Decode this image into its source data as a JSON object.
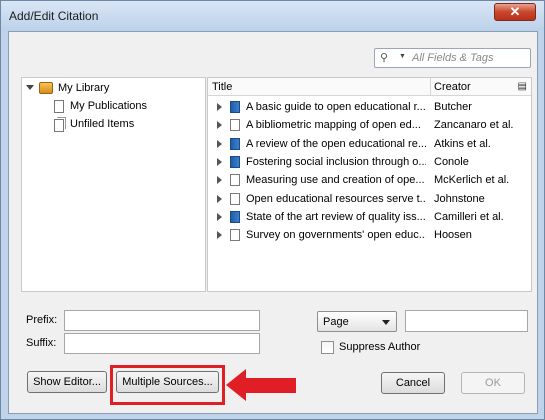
{
  "window": {
    "title": "Add/Edit Citation",
    "close_label": "✕"
  },
  "search": {
    "placeholder": "All Fields & Tags"
  },
  "tree": {
    "items": [
      {
        "label": "My Library"
      },
      {
        "label": "My Publications"
      },
      {
        "label": "Unfiled Items"
      }
    ]
  },
  "table": {
    "headers": {
      "title": "Title",
      "creator": "Creator"
    },
    "rows": [
      {
        "title": "A basic guide to open educational r...",
        "creator": "Butcher",
        "icon": "book"
      },
      {
        "title": "A bibliometric mapping of open ed...",
        "creator": "Zancanaro et al.",
        "icon": "page"
      },
      {
        "title": "A review of the open educational re...",
        "creator": "Atkins et al.",
        "icon": "book"
      },
      {
        "title": "Fostering social inclusion through o...",
        "creator": "Conole",
        "icon": "book"
      },
      {
        "title": "Measuring use and creation of ope...",
        "creator": "McKerlich et al.",
        "icon": "page"
      },
      {
        "title": "Open educational resources serve t...",
        "creator": "Johnstone",
        "icon": "page"
      },
      {
        "title": "State of the art review of quality iss...",
        "creator": "Camilleri et al.",
        "icon": "book"
      },
      {
        "title": "Survey on governments' open educ...",
        "creator": "Hoosen",
        "icon": "page"
      }
    ]
  },
  "form": {
    "prefix_label": "Prefix:",
    "suffix_label": "Suffix:",
    "locator_select": "Page",
    "suppress_author_label": "Suppress Author"
  },
  "buttons": {
    "show_editor": "Show Editor...",
    "multiple_sources": "Multiple Sources...",
    "cancel": "Cancel",
    "ok": "OK"
  },
  "colors": {
    "highlight": "#e01e26",
    "arrow": "#e01e26"
  }
}
